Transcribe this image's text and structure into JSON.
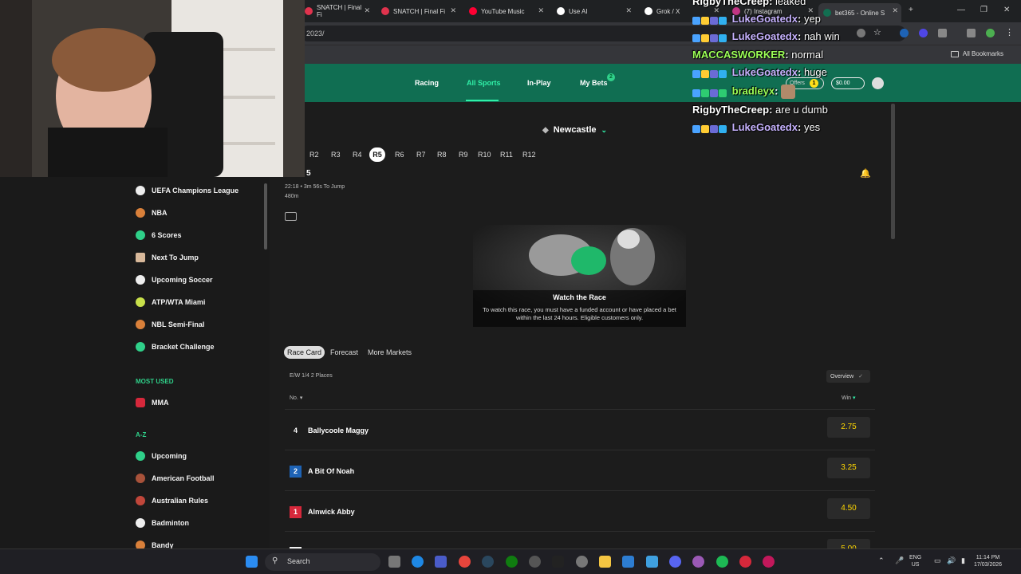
{
  "browser": {
    "tabs": [
      {
        "title": "SNATCH | Final Fi",
        "color": "#e0334d"
      },
      {
        "title": "SNATCH | Final Fi",
        "color": "#e0334d"
      },
      {
        "title": "YouTube Music",
        "color": "#ff0033"
      },
      {
        "title": "Use AI",
        "color": "#ffffff"
      },
      {
        "title": "Grok / X",
        "color": "#ffffff"
      },
      {
        "title": "(7) Instagram",
        "color": "#c13584"
      },
      {
        "title": "bet365 - Online S",
        "color": "#126e51"
      }
    ],
    "url": "2023/",
    "bookmarks_label": "All Bookmarks"
  },
  "nav": {
    "racing": "Racing",
    "all_sports": "All Sports",
    "in_play": "In-Play",
    "my_bets": "My Bets",
    "my_bets_count": "2",
    "offers": "Offers",
    "offers_count": "1",
    "balance": "$0.00"
  },
  "sidebar": {
    "items_top": [
      {
        "label": "UEFA Champions League",
        "icon": "soccer-ball-icon"
      },
      {
        "label": "NBA",
        "icon": "basketball-icon"
      },
      {
        "label": "6 Scores",
        "icon": "6-scores-icon"
      },
      {
        "label": "Next To Jump",
        "icon": "greyhound-icon"
      },
      {
        "label": "Upcoming Soccer",
        "icon": "soccer-ball-icon"
      },
      {
        "label": "ATP/WTA Miami",
        "icon": "tennis-ball-icon"
      },
      {
        "label": "NBL Semi-Final",
        "icon": "basketball-icon"
      },
      {
        "label": "Bracket Challenge",
        "icon": "bracket-icon"
      }
    ],
    "most_used_heading": "MOST USED",
    "most_used": [
      {
        "label": "MMA",
        "icon": "glove-icon"
      }
    ],
    "az_heading": "A-Z",
    "az_items": [
      {
        "label": "Upcoming",
        "icon": "clock-icon"
      },
      {
        "label": "American Football",
        "icon": "american-football-icon"
      },
      {
        "label": "Australian Rules",
        "icon": "australian-rules-icon"
      },
      {
        "label": "Badminton",
        "icon": "shuttlecock-icon"
      },
      {
        "label": "Bandy",
        "icon": "bandy-icon"
      }
    ]
  },
  "race": {
    "venue": "Newcastle",
    "race_tabs": [
      "R2",
      "R3",
      "R4",
      "R5",
      "R6",
      "R7",
      "R8",
      "R9",
      "R10",
      "R11",
      "R12"
    ],
    "active_tab": "R5",
    "race_number": "5",
    "time_info": "22:18 • 3m 56s To Jump",
    "distance": "480m",
    "watch_title": "Watch the Race",
    "watch_text": "To watch this race, you must have a funded account or have placed a bet within the last 24 hours. Eligible customers only."
  },
  "racecard": {
    "tabs": [
      "Race Card",
      "Forecast",
      "More Markets"
    ],
    "each_way": "E/W 1/4 2 Places",
    "overview_label": "Overview",
    "col_no": "No.",
    "col_win": "Win",
    "runners": [
      {
        "no": "4",
        "name": "Ballycoole Maggy",
        "odds": "2.75",
        "color": "#1c1c1c"
      },
      {
        "no": "2",
        "name": "A Bit Of Noah",
        "odds": "3.25",
        "color": "#1e63b5"
      },
      {
        "no": "1",
        "name": "Alnwick Abby",
        "odds": "4.50",
        "color": "#d6283b"
      },
      {
        "no": "",
        "name": "",
        "odds": "5.00",
        "color": "#f0f0f0"
      }
    ]
  },
  "chat": [
    {
      "user": "RigbyTheCreep",
      "msg": "leaked",
      "color": "#ffffff",
      "badges": false
    },
    {
      "user": "LukeGoatedx",
      "msg": "yep",
      "color": "#a78bfa",
      "badges": true
    },
    {
      "user": "LukeGoatedx",
      "msg": "nah win",
      "color": "#a78bfa",
      "badges": true
    },
    {
      "user": "MACCASWORKER",
      "msg": "normal",
      "color": "#7cfc00",
      "badges": false
    },
    {
      "user": "LukeGoatedx",
      "msg": "huge",
      "color": "#a78bfa",
      "badges": true
    },
    {
      "user": "bradleyx",
      "msg": "",
      "color": "#7cfc00",
      "badges": true
    },
    {
      "user": "RigbyTheCreep",
      "msg": "are u dumb",
      "color": "#ffffff",
      "badges": false
    },
    {
      "user": "LukeGoatedx",
      "msg": "yes",
      "color": "#a78bfa",
      "badges": true
    }
  ],
  "taskbar": {
    "search": "Search",
    "lang": "ENG",
    "region": "US",
    "time": "11:14 PM",
    "date": "17/03/2026"
  }
}
